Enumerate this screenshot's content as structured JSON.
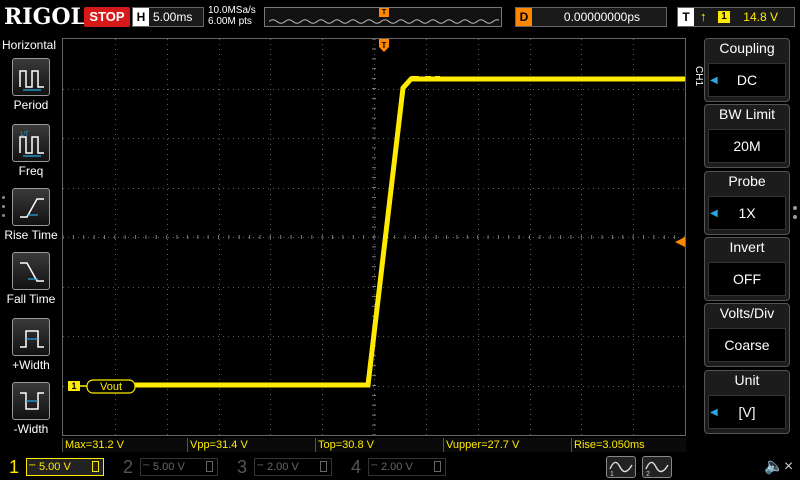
{
  "brand": "RIGOL",
  "run_state": "STOP",
  "horizontal": {
    "label": "H",
    "scale": "5.00ms"
  },
  "sample_rate": "10.0MSa/s",
  "memory_depth": "6.00M pts",
  "trigger_marker": "T",
  "delay": {
    "label": "D",
    "value": "0.00000000ps"
  },
  "trigger": {
    "label": "T",
    "source": "1",
    "level": "14.8 V"
  },
  "left_menu": {
    "title": "Horizontal",
    "items": [
      {
        "label": "Period",
        "icon": "period-icon"
      },
      {
        "label": "Freq",
        "icon": "frequency-icon"
      },
      {
        "label": "Rise Time",
        "icon": "rise-time-icon"
      },
      {
        "label": "Fall Time",
        "icon": "fall-time-icon"
      },
      {
        "label": "+Width",
        "icon": "positive-width-icon"
      },
      {
        "label": "-Width",
        "icon": "negative-width-icon"
      }
    ]
  },
  "right_menu": {
    "channel_tag": "CH1",
    "items": [
      {
        "title": "Coupling",
        "value": "DC",
        "arrow": true
      },
      {
        "title": "BW Limit",
        "value": "20M",
        "arrow": false
      },
      {
        "title": "Probe",
        "value": "1X",
        "arrow": true
      },
      {
        "title": "Invert",
        "value": "OFF",
        "arrow": false
      },
      {
        "title": "Volts/Div",
        "value": "Coarse",
        "arrow": false
      },
      {
        "title": "Unit",
        "value": "[V]",
        "arrow": true
      }
    ]
  },
  "trace": {
    "channel_marker": "1",
    "label": "Vout",
    "color": "#ffeb00"
  },
  "measurements": [
    {
      "text": "Max=31.2 V"
    },
    {
      "text": "Vpp=31.4 V"
    },
    {
      "text": "Top=30.8 V"
    },
    {
      "text": "Vupper=27.7 V"
    },
    {
      "text": "Rise=3.050ms"
    }
  ],
  "channels": [
    {
      "num": "1",
      "scale": "5.00 V",
      "color": "#ffeb00",
      "active": true
    },
    {
      "num": "2",
      "scale": "5.00 V",
      "color": "#00c8c8",
      "active": false
    },
    {
      "num": "3",
      "scale": "2.00 V",
      "color": "#d040d0",
      "active": false
    },
    {
      "num": "4",
      "scale": "2.00 V",
      "color": "#3070ff",
      "active": false
    }
  ],
  "colors": {
    "stop": "#d61a1a",
    "delay_accent": "#ff8800",
    "menu_arrow": "#29a8e0",
    "grid": "#6a6a6a"
  }
}
